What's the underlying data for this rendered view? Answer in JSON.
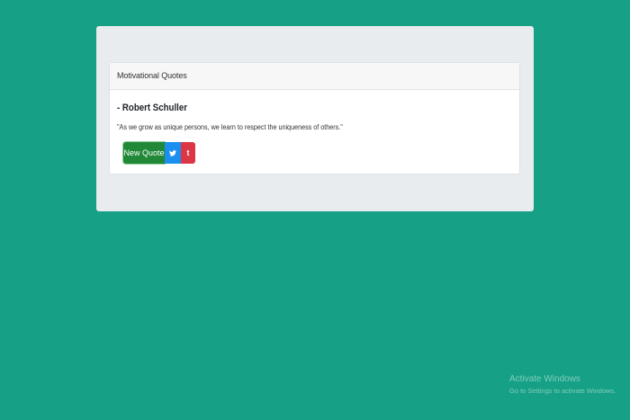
{
  "card": {
    "header": "Motivational Quotes",
    "author": "- Robert Schuller",
    "quote": "\"As we grow as unique persons, we learn to respect the uniqueness of others.\""
  },
  "buttons": {
    "new_quote": "New Quote",
    "twitter_icon": "twitter-bird",
    "tumblr_icon": "t"
  },
  "watermark": {
    "title": "Activate Windows",
    "subtitle": "Go to Settings to activate Windows."
  },
  "colors": {
    "background": "#16a085",
    "new_quote_button": "#218838",
    "twitter_button": "#1a8ff0",
    "tumblr_button": "#dc3545"
  }
}
